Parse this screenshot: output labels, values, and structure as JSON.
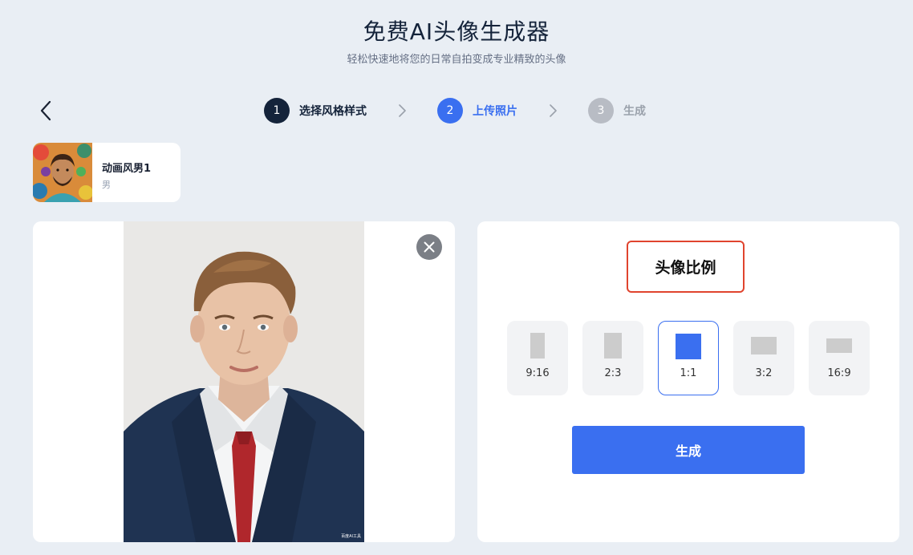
{
  "header": {
    "title": "免费AI头像生成器",
    "subtitle": "轻松快速地将您的日常自拍变成专业精致的头像"
  },
  "steps": [
    {
      "number": "1",
      "label": "选择风格样式",
      "state": "completed",
      "color": "#14233a"
    },
    {
      "number": "2",
      "label": "上传照片",
      "state": "active",
      "color": "#3a6ff0"
    },
    {
      "number": "3",
      "label": "生成",
      "state": "pending",
      "color": "#b8bcc4"
    }
  ],
  "selected_style": {
    "name": "动画风男1",
    "gender": "男"
  },
  "upload": {
    "watermark": "百度AI工具"
  },
  "settings": {
    "ratio_title": "头像比例",
    "ratios": [
      {
        "label": "9:16",
        "selected": false
      },
      {
        "label": "2:3",
        "selected": false
      },
      {
        "label": "1:1",
        "selected": true
      },
      {
        "label": "3:2",
        "selected": false
      },
      {
        "label": "16:9",
        "selected": false
      }
    ],
    "generate_label": "生成"
  },
  "colors": {
    "accent": "#3a6ff0",
    "highlight_border": "#e0442e",
    "background": "#e9eef4"
  },
  "icons": {
    "back": "chevron-left-icon",
    "step_separator": "chevron-right-icon",
    "remove_photo": "close-icon"
  }
}
